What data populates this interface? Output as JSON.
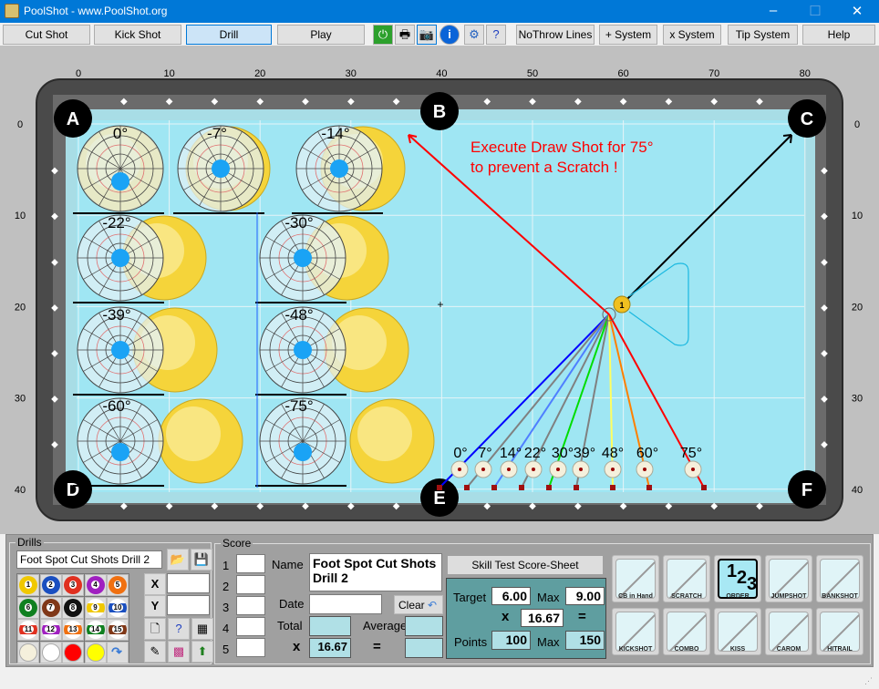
{
  "window": {
    "title": "PoolShot - www.PoolShot.org",
    "controls": [
      "–",
      "☐",
      "✕"
    ]
  },
  "toolbar": {
    "buttons": [
      "Cut Shot",
      "Kick Shot",
      "Drill",
      "Play"
    ],
    "selected": "Drill",
    "icons": [
      "power-icon",
      "print-icon",
      "camera-icon",
      "info-icon",
      "settings-icon",
      "help-doc-icon"
    ],
    "buttons2": [
      "NoThrow Lines",
      "+ System",
      "x System",
      "Tip System",
      "Help"
    ]
  },
  "table": {
    "x_ticks": [
      "0",
      "10",
      "20",
      "30",
      "40",
      "50",
      "60",
      "70",
      "80"
    ],
    "y_ticks": [
      "0",
      "10",
      "20",
      "30",
      "40"
    ],
    "pockets": [
      "A",
      "B",
      "C",
      "D",
      "E",
      "F"
    ],
    "annotation_lines": [
      "Execute Draw Shot for 75°",
      "to prevent a Scratch !"
    ],
    "diagrams": [
      {
        "label": "0°",
        "angle": 0
      },
      {
        "label": "-7°",
        "angle": -7
      },
      {
        "label": "-14°",
        "angle": -14
      },
      {
        "label": "-22°",
        "angle": -22
      },
      {
        "label": "-30°",
        "angle": -30
      },
      {
        "label": "-39°",
        "angle": -39
      },
      {
        "label": "-48°",
        "angle": -48
      },
      {
        "label": "-60°",
        "angle": -60
      },
      {
        "label": "-75°",
        "angle": -75
      }
    ],
    "object_ball": "1",
    "shots": [
      {
        "label": "0°",
        "color": "#0000ff"
      },
      {
        "label": "7°",
        "color": "#808080"
      },
      {
        "label": "14°",
        "color": "#4f7fff"
      },
      {
        "label": "22°",
        "color": "#808080"
      },
      {
        "label": "30°",
        "color": "#00dd00"
      },
      {
        "label": "39°",
        "color": "#808080"
      },
      {
        "label": "48°",
        "color": "#ffff60"
      },
      {
        "label": "60°",
        "color": "#ff8000"
      },
      {
        "label": "75°",
        "color": "#ff0000"
      }
    ],
    "colors": {
      "cloth": "#9fe6f3",
      "rail": "#5a5a5a",
      "cushion": "#a8dde6",
      "annotation": "#ff0000"
    }
  },
  "drills": {
    "legend": "Drills",
    "name": "Foot Spot Cut Shots Drill 2",
    "balls": [
      "1",
      "2",
      "3",
      "4",
      "5",
      "6",
      "7",
      "8",
      "9",
      "10",
      "11",
      "12",
      "13",
      "14",
      "15"
    ],
    "x_label": "X",
    "y_label": "Y",
    "x_value": "",
    "y_value": ""
  },
  "score": {
    "legend": "Score",
    "rows": [
      "1",
      "2",
      "3",
      "4",
      "5"
    ],
    "name_label": "Name",
    "name_value": "Foot Spot Cut Shots Drill 2",
    "date_label": "Date",
    "clear_label": "Clear",
    "total_label": "Total",
    "average_label": "Average",
    "x_label": "x",
    "x_value": "16.67",
    "eq": "="
  },
  "skill": {
    "title": "Skill Test Score-Sheet",
    "target_label": "Target",
    "target": "6.00",
    "max_label": "Max",
    "max": "9.00",
    "x_label": "x",
    "x_value": "16.67",
    "eq": "=",
    "points_label": "Points",
    "points": "100",
    "points_max": "150"
  },
  "shot_types": [
    {
      "label": "CB in Hand",
      "active": false
    },
    {
      "label": "SCRATCH",
      "active": false
    },
    {
      "label": "ORDER",
      "active": true
    },
    {
      "label": "JUMPSHOT",
      "active": false
    },
    {
      "label": "BANKSHOT",
      "active": false
    },
    {
      "label": "KICKSHOT",
      "active": false
    },
    {
      "label": "COMBO",
      "active": false
    },
    {
      "label": "KISS",
      "active": false
    },
    {
      "label": "CAROM",
      "active": false
    },
    {
      "label": "HITRAIL",
      "active": false
    }
  ],
  "order_glyph": [
    "1",
    "2",
    "3"
  ]
}
